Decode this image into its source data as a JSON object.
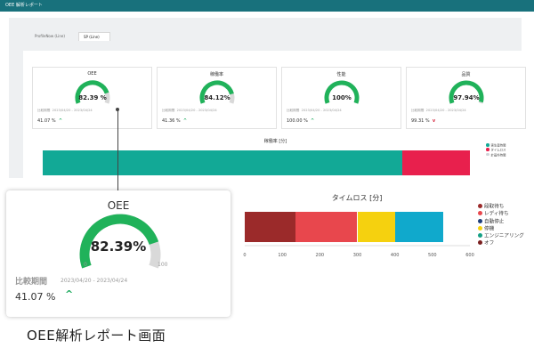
{
  "app": {
    "title": "OEE 解析レポート",
    "tabs": [
      {
        "label": "ProfileNow (Line)"
      },
      {
        "label": "SP (Line)"
      }
    ],
    "metrics": [
      {
        "title": "OEE",
        "value_text": "82.39 %",
        "value": 82.39,
        "compare_label": "比較期間",
        "compare_date": "2023/04/20 - 2023/04/24",
        "compare_pct": "41.07 %",
        "trend": "up",
        "gauge_min": "0",
        "gauge_max": "100"
      },
      {
        "title": "稼働率",
        "value_text": "84.12%",
        "value": 84.12,
        "compare_label": "比較期間",
        "compare_date": "2023/04/20 - 2023/04/24",
        "compare_pct": "41.36 %",
        "trend": "up",
        "gauge_min": "0",
        "gauge_max": "100"
      },
      {
        "title": "性能",
        "value_text": "100%",
        "value": 100,
        "compare_label": "比較期間",
        "compare_date": "2023/04/20 - 2023/04/24",
        "compare_pct": "100.00 %",
        "trend": "up",
        "gauge_min": "0",
        "gauge_max": "100"
      },
      {
        "title": "品質",
        "value_text": "97.94%",
        "value": 97.94,
        "compare_label": "比較期間",
        "compare_date": "2023/04/20 - 2023/04/24",
        "compare_pct": "99.31 %",
        "trend": "down",
        "gauge_min": "0",
        "gauge_max": "100"
      }
    ],
    "operating_chart": {
      "title": "稼働率 [分]",
      "segments": [
        {
          "value": 2830,
          "color": "#12a996"
        },
        {
          "value": 530,
          "color": "#e8204d"
        }
      ],
      "ticks": [
        "0",
        "500",
        "1,000",
        "1,500",
        "2,000",
        "2,500",
        "3,000",
        "3,500"
      ],
      "legend": [
        {
          "label": "実生産時間",
          "color": "#12a996"
        },
        {
          "label": "タイムロス",
          "color": "#e8204d"
        },
        {
          "label": "計画外時間",
          "color": "#cfd4d8"
        }
      ]
    }
  },
  "zoom": {
    "title": "OEE",
    "value_text": "82.39%",
    "value": 82.39,
    "gauge_min": "0",
    "gauge_max": "100",
    "compare_label": "比較期間",
    "compare_date": "2023/04/20 - 2023/04/24",
    "compare_pct": "41.07 %",
    "trend_symbol": "^",
    "colors": {
      "gauge_fill": "#20b25a",
      "gauge_track": "#d9d9d9",
      "trend": "#19a95b"
    }
  },
  "chart_data": {
    "type": "bar",
    "title": "タイムロス [分]",
    "orientation": "horizontal-stacked",
    "categories": [
      "タイムロス"
    ],
    "series": [
      {
        "name": "段取待ち",
        "values": [
          135
        ],
        "color": "#9b2a2a"
      },
      {
        "name": "レディ待ち",
        "values": [
          165
        ],
        "color": "#e8474d"
      },
      {
        "name": "自動停止",
        "values": [
          100
        ],
        "color": "#f5d10f"
      },
      {
        "name": "停機",
        "values": [
          130
        ],
        "color": "#10a9cc"
      },
      {
        "name": "エンジニアリング",
        "values": [
          0
        ],
        "color": "#16a085"
      },
      {
        "name": "オフ",
        "values": [
          0
        ],
        "color": "#7a1f1f"
      }
    ],
    "legend_extra_colors": [
      "#1d3e7a"
    ],
    "xticks": [
      "0",
      "100",
      "200",
      "300",
      "400",
      "500",
      "600"
    ],
    "xlim": [
      0,
      600
    ],
    "legend_position": "right",
    "grid": false
  },
  "caption": "OEE解析レポート画面"
}
